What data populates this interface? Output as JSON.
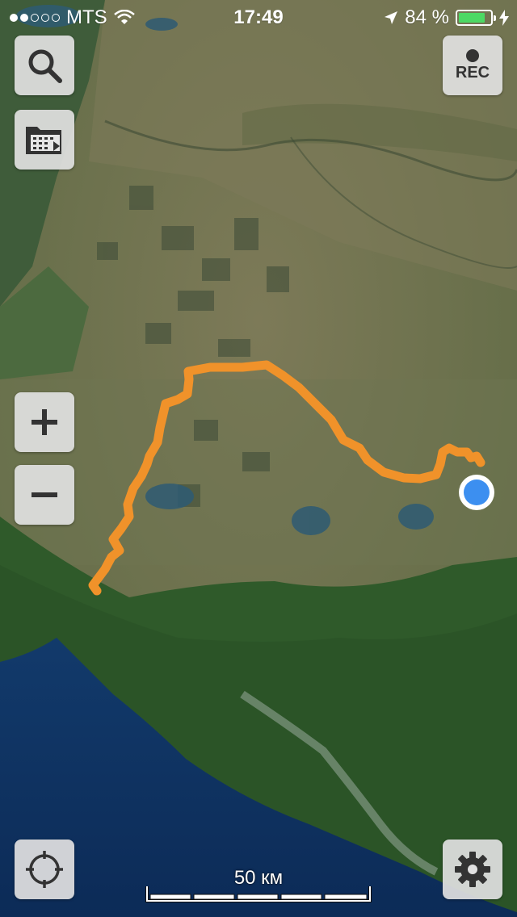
{
  "status_bar": {
    "carrier": "MTS",
    "time": "17:49",
    "battery_percent": "84 %",
    "battery_level": 0.84,
    "signal_bars_filled": 2,
    "signal_bars_total": 5
  },
  "map": {
    "scale_label": "50 км",
    "track_color": "#f0922a",
    "location_color": "#3c8ff0"
  },
  "buttons": {
    "record_label": "REC",
    "search_icon": "search-icon",
    "folder_icon": "folder-export-icon",
    "zoom_in_icon": "plus-icon",
    "zoom_out_icon": "minus-icon",
    "locate_icon": "crosshair-icon",
    "settings_icon": "gear-icon"
  }
}
